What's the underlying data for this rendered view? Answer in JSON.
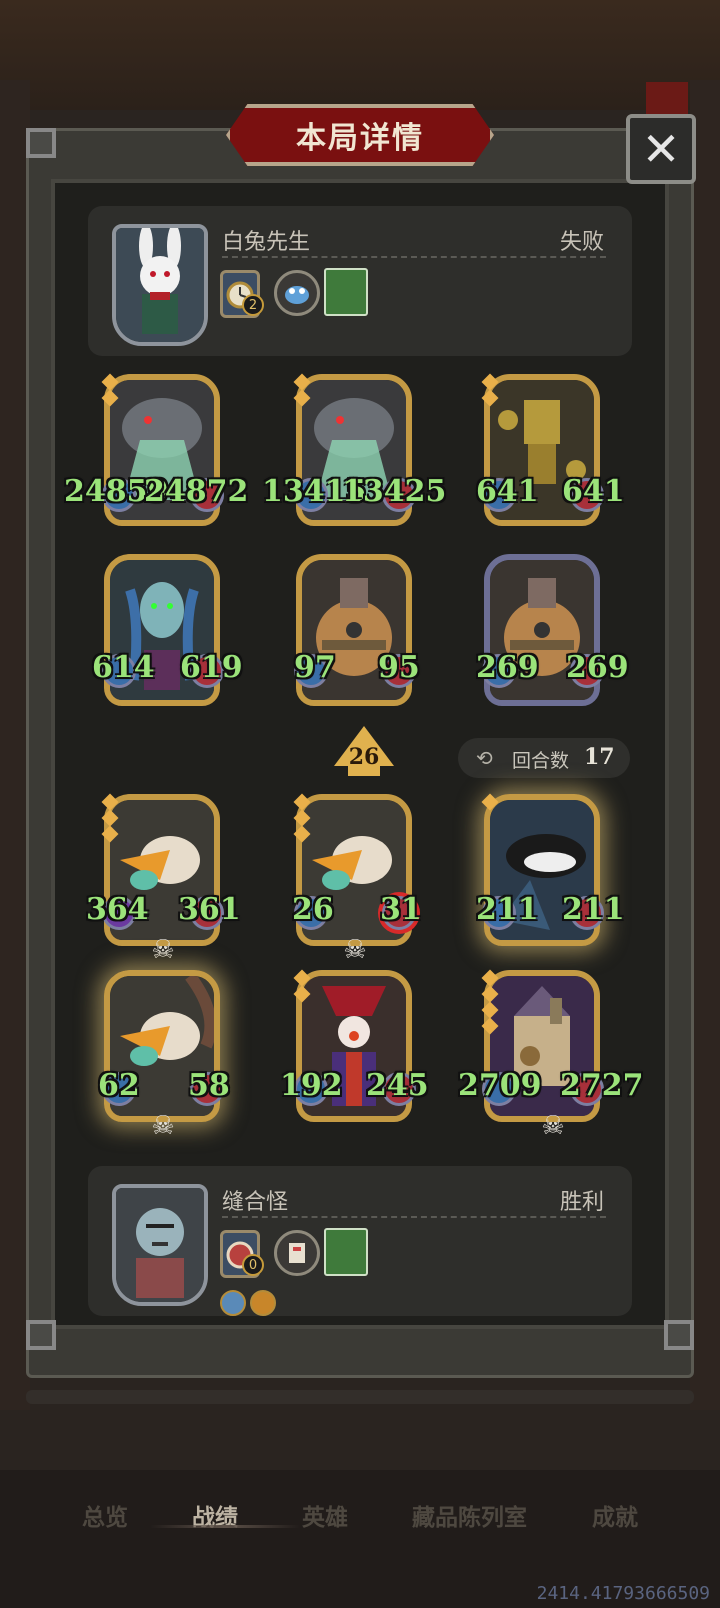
{
  "title": "本局详情",
  "close_label": "✕",
  "opponent": {
    "name": "白兔先生",
    "result": "失败",
    "badge_count": "2"
  },
  "player": {
    "name": "缝合怪",
    "result": "胜利",
    "badge_count": "0"
  },
  "opponent_cards": [
    {
      "atk": "24859",
      "hp": "24872"
    },
    {
      "atk": "13415",
      "hp": "13425"
    },
    {
      "atk": "641",
      "hp": "641"
    },
    {
      "atk": "614",
      "hp": "619"
    },
    {
      "atk": "97",
      "hp": "95"
    },
    {
      "atk": "269",
      "hp": "269"
    }
  ],
  "player_cards": [
    {
      "atk": "364",
      "hp": "361"
    },
    {
      "atk": "26",
      "hp": "31"
    },
    {
      "atk": "211",
      "hp": "211"
    },
    {
      "atk": "62",
      "hp": "58"
    },
    {
      "atk": "192",
      "hp": "245"
    },
    {
      "atk": "2709",
      "hp": "2727"
    }
  ],
  "divider_value": "26",
  "turns": {
    "label": "回合数",
    "value": "17"
  },
  "nav": {
    "items": [
      "总览",
      "战绩",
      "英雄",
      "藏品陈列室",
      "成就"
    ],
    "active": "战绩"
  },
  "footer_number": "2414.41793666509",
  "colors": {
    "stat_green": "#9be37a",
    "gold_border": "#c49a44",
    "title_red": "#7a1010"
  }
}
